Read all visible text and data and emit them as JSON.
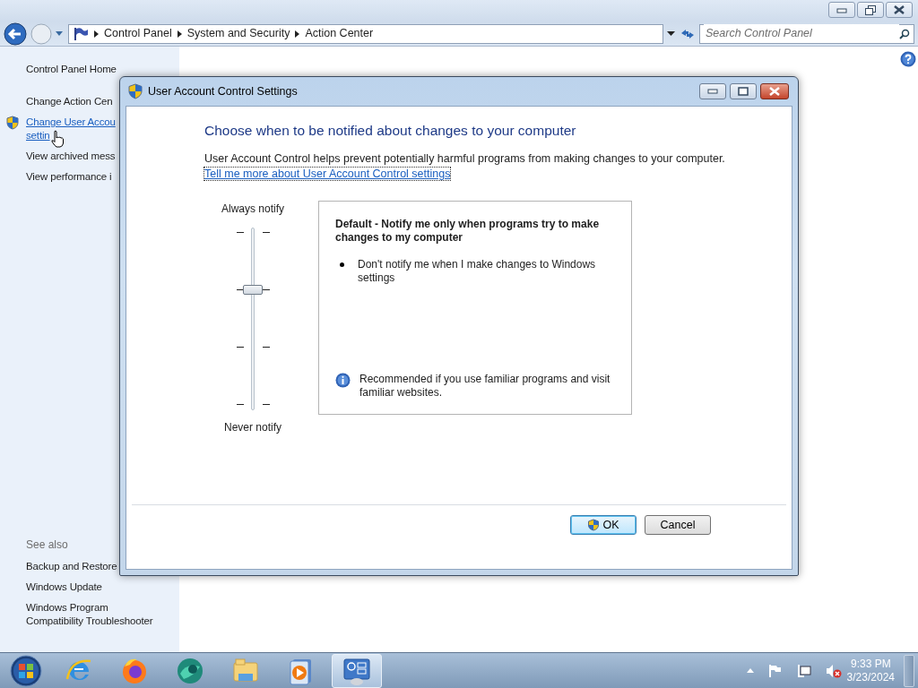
{
  "address_bar": {
    "breadcrumbs": [
      "Control Panel",
      "System and Security",
      "Action Center"
    ]
  },
  "search": {
    "placeholder": "Search Control Panel"
  },
  "sidebar": {
    "links": [
      {
        "lines": [
          "Control Panel Home"
        ],
        "kind": "plain",
        "hovered": false
      },
      {
        "lines": [
          "Change Action Cen"
        ],
        "kind": "plain",
        "hovered": false
      },
      {
        "lines": [
          "Change User Accou",
          "settin"
        ],
        "kind": "shield",
        "hovered": true
      },
      {
        "lines": [
          "View archived mess"
        ],
        "kind": "plain",
        "hovered": false
      },
      {
        "lines": [
          "View performance i"
        ],
        "kind": "plain",
        "hovered": false
      }
    ],
    "see_also_label": "See also",
    "see_also": [
      {
        "lines": [
          "Backup and Restore"
        ]
      },
      {
        "lines": [
          "Windows Update"
        ]
      },
      {
        "lines": [
          "Windows Program",
          "Compatibility Troubleshooter"
        ]
      }
    ]
  },
  "dialog": {
    "title": "User Account Control Settings",
    "heading": "Choose when to be notified about changes to your computer",
    "description": "User Account Control helps prevent potentially harmful programs from making changes to your computer.",
    "link": "Tell me more about User Account Control settings",
    "slider": {
      "top_label": "Always notify",
      "bottom_label": "Never notify",
      "level": 0.667
    },
    "panel": {
      "title": "Default - Notify me only when programs try to make changes to my computer",
      "bullets": [
        "Don't notify me when I make changes to Windows settings"
      ],
      "note": "Recommended if you use familiar programs and visit familiar websites."
    },
    "buttons": [
      {
        "label": "OK",
        "default": true
      },
      {
        "label": "Cancel",
        "default": false
      }
    ]
  },
  "taskbar": {
    "apps": [
      {
        "kind": "ie",
        "active": false
      },
      {
        "kind": "firefox",
        "active": false
      },
      {
        "kind": "globe",
        "active": false
      },
      {
        "kind": "folder",
        "active": false
      },
      {
        "kind": "media",
        "active": false
      },
      {
        "kind": "control",
        "active": true
      }
    ],
    "clock": {
      "time": "9:33 PM",
      "date": "3/23/2024"
    }
  }
}
